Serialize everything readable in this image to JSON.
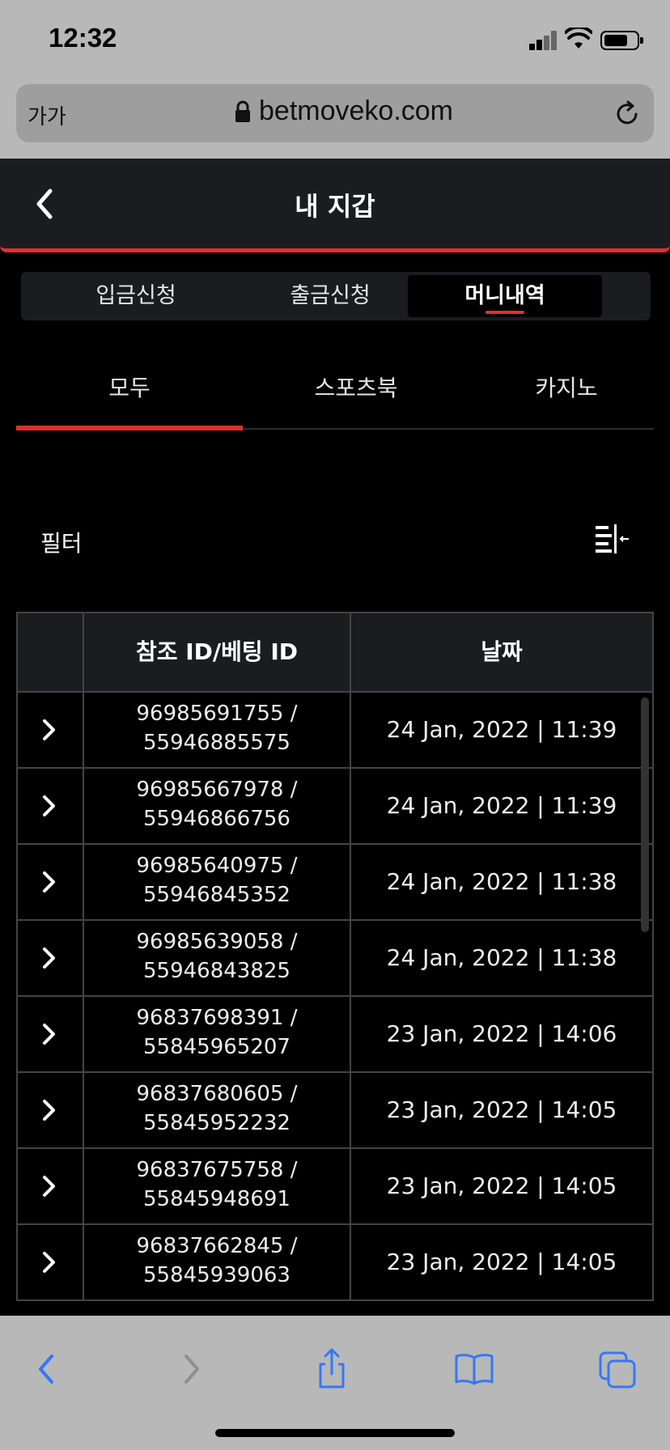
{
  "status_bar": {
    "time": "12:32"
  },
  "browser": {
    "text_size_button": "가가",
    "url": "betmoveko.com"
  },
  "header": {
    "title": "내 지갑"
  },
  "segment_tabs": [
    {
      "label": "입금신청",
      "active": false
    },
    {
      "label": "출금신청",
      "active": false
    },
    {
      "label": "머니내역",
      "active": true
    }
  ],
  "category_tabs": [
    {
      "label": "모두",
      "active": true
    },
    {
      "label": "스포츠북",
      "active": false
    },
    {
      "label": "카지노",
      "active": false
    }
  ],
  "filter": {
    "label": "필터"
  },
  "table": {
    "columns": [
      "",
      "참조 ID/베팅 ID",
      "날짜"
    ],
    "rows": [
      {
        "ref_id": "96985691755 /",
        "bet_id": "55946885575",
        "date": "24 Jan, 2022 | 11:39"
      },
      {
        "ref_id": "96985667978 /",
        "bet_id": "55946866756",
        "date": "24 Jan, 2022 | 11:39"
      },
      {
        "ref_id": "96985640975 /",
        "bet_id": "55946845352",
        "date": "24 Jan, 2022 | 11:38"
      },
      {
        "ref_id": "96985639058 /",
        "bet_id": "55946843825",
        "date": "24 Jan, 2022 | 11:38"
      },
      {
        "ref_id": "96837698391 /",
        "bet_id": "55845965207",
        "date": "23 Jan, 2022 | 14:06"
      },
      {
        "ref_id": "96837680605 /",
        "bet_id": "55845952232",
        "date": "23 Jan, 2022 | 14:05"
      },
      {
        "ref_id": "96837675758 /",
        "bet_id": "55845948691",
        "date": "23 Jan, 2022 | 14:05"
      },
      {
        "ref_id": "96837662845 /",
        "bet_id": "55845939063",
        "date": "23 Jan, 2022 | 14:05"
      }
    ]
  },
  "icons": {
    "back": "chevron-left-icon",
    "row_expand": "chevron-right-icon",
    "filter": "filter-collapse-icon",
    "toolbar": [
      "back-icon",
      "forward-icon",
      "share-icon",
      "bookmarks-icon",
      "tabs-icon"
    ]
  },
  "colors": {
    "accent": "#e0302a",
    "toolbar_icon": "#3478f6",
    "header_bg": "#1b1c20"
  }
}
